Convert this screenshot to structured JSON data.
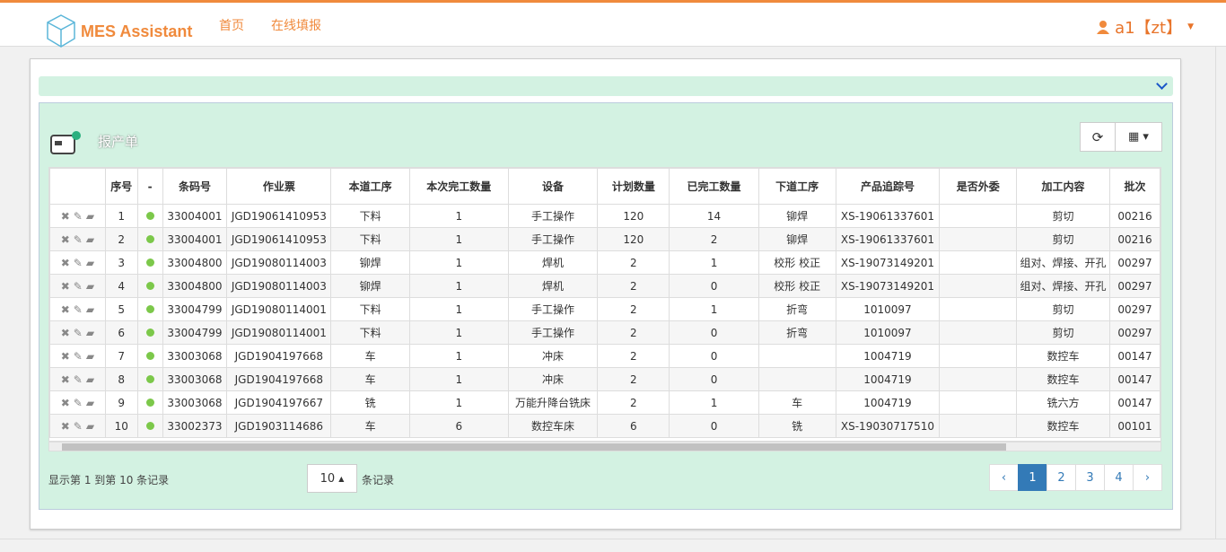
{
  "brand": "MES Assistant",
  "nav": [
    "首页",
    "在线填报"
  ],
  "user": "a1【zt】",
  "grid_title": "报产单",
  "columns": [
    "",
    "序号",
    "-",
    "条码号",
    "作业票",
    "本道工序",
    "本次完工数量",
    "设备",
    "计划数量",
    "已完工数量",
    "下道工序",
    "产品追踪号",
    "是否外委",
    "加工内容",
    "批次"
  ],
  "rows": [
    [
      "1",
      "33004001",
      "JGD19061410953",
      "下料",
      "1",
      "手工操作",
      "120",
      "14",
      "铆焊",
      "XS-19061337601",
      "",
      "剪切",
      "00216"
    ],
    [
      "2",
      "33004001",
      "JGD19061410953",
      "下料",
      "1",
      "手工操作",
      "120",
      "2",
      "铆焊",
      "XS-19061337601",
      "",
      "剪切",
      "00216"
    ],
    [
      "3",
      "33004800",
      "JGD19080114003",
      "铆焊",
      "1",
      "焊机",
      "2",
      "1",
      "校形 校正",
      "XS-19073149201",
      "",
      "组对、焊接、开孔",
      "00297"
    ],
    [
      "4",
      "33004800",
      "JGD19080114003",
      "铆焊",
      "1",
      "焊机",
      "2",
      "0",
      "校形 校正",
      "XS-19073149201",
      "",
      "组对、焊接、开孔",
      "00297"
    ],
    [
      "5",
      "33004799",
      "JGD19080114001",
      "下料",
      "1",
      "手工操作",
      "2",
      "1",
      "折弯",
      "1010097",
      "",
      "剪切",
      "00297"
    ],
    [
      "6",
      "33004799",
      "JGD19080114001",
      "下料",
      "1",
      "手工操作",
      "2",
      "0",
      "折弯",
      "1010097",
      "",
      "剪切",
      "00297"
    ],
    [
      "7",
      "33003068",
      "JGD1904197668",
      "车",
      "1",
      "冲床",
      "2",
      "0",
      "",
      "1004719",
      "",
      "数控车",
      "00147"
    ],
    [
      "8",
      "33003068",
      "JGD1904197668",
      "车",
      "1",
      "冲床",
      "2",
      "0",
      "",
      "1004719",
      "",
      "数控车",
      "00147"
    ],
    [
      "9",
      "33003068",
      "JGD1904197667",
      "铣",
      "1",
      "万能升降台铣床",
      "2",
      "1",
      "车",
      "1004719",
      "",
      "铣六方",
      "00147"
    ],
    [
      "10",
      "33002373",
      "JGD1903114686",
      "车",
      "6",
      "数控车床",
      "6",
      "0",
      "铣",
      "XS-19030717510",
      "",
      "数控车",
      "00101"
    ]
  ],
  "pagination": {
    "info": "显示第 1 到第 10 条记录",
    "size": "10",
    "suffix": "条记录",
    "pages": [
      "‹",
      "1",
      "2",
      "3",
      "4",
      "›"
    ]
  }
}
